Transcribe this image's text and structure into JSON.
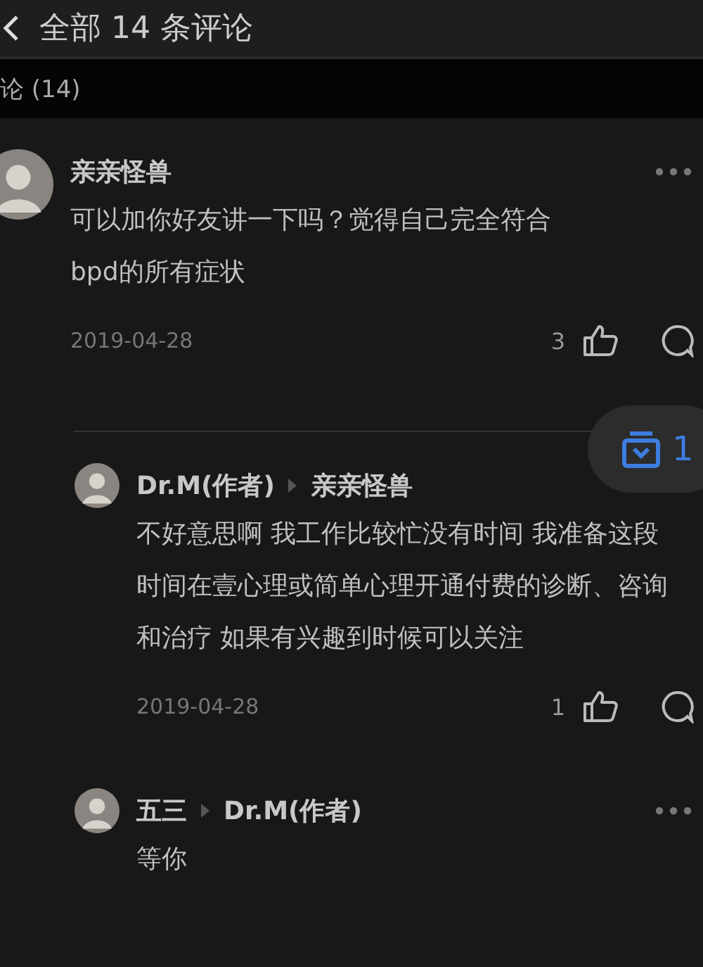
{
  "header": {
    "title": "全部 14 条评论"
  },
  "section": {
    "title": "论 (14)"
  },
  "comments": [
    {
      "kind": "comment",
      "author": "亲亲怪兽",
      "more_menu": true,
      "text": "可以加你好友讲一下吗？觉得自己完全符合bpd的所有症状",
      "date": "2019-04-28",
      "likes": "3"
    },
    {
      "kind": "reply",
      "author": "Dr.M(作者)",
      "reply_to": "亲亲怪兽",
      "more_menu": false,
      "text": "不好意思啊 我工作比较忙没有时间 我准备这段时间在壹心理或简单心理开通付费的诊断、咨询和治疗 如果有兴趣到时候可以关注",
      "date": "2019-04-28",
      "likes": "1"
    },
    {
      "kind": "reply",
      "author": "五三",
      "reply_to": "Dr.M(作者)",
      "more_menu": true,
      "text": "等你"
    }
  ],
  "floating_button": {
    "count": "1"
  }
}
